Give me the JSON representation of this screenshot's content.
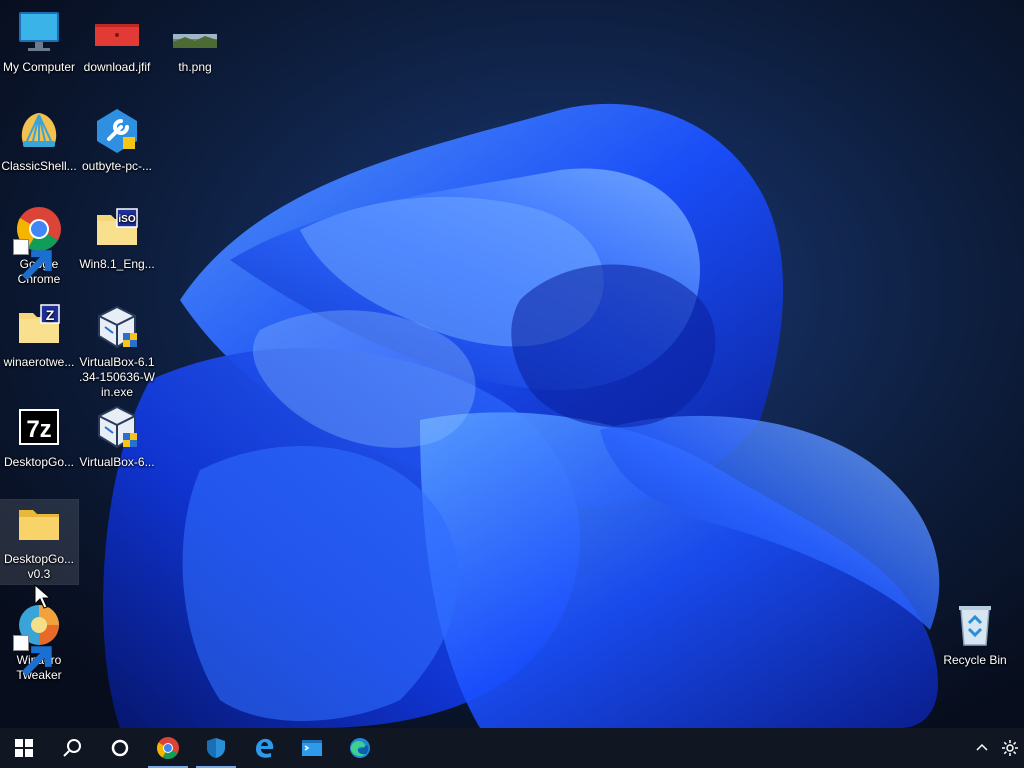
{
  "desktop": {
    "icons": [
      {
        "id": "my-computer",
        "label": "My Computer",
        "icon": "monitor-icon"
      },
      {
        "id": "download-jfif",
        "label": "download.jfif",
        "icon": "image-file-icon"
      },
      {
        "id": "th-png",
        "label": "th.png",
        "icon": "image-file-icon"
      },
      {
        "id": "classicshell",
        "label": "ClassicShell...",
        "icon": "shell-icon"
      },
      {
        "id": "outbyte",
        "label": "outbyte-pc-...",
        "icon": "wrench-icon"
      },
      {
        "id": "google-chrome",
        "label": "Google Chrome",
        "icon": "chrome-icon"
      },
      {
        "id": "win81",
        "label": "Win8.1_Eng...",
        "icon": "iso-folder-icon"
      },
      {
        "id": "winaerotweaker-zip",
        "label": "winaerotwe...",
        "icon": "zip-folder-icon"
      },
      {
        "id": "virtualbox-exe",
        "label": "VirtualBox-6.1.34-150636-Win.exe",
        "icon": "virtualbox-icon"
      },
      {
        "id": "desktopgo-7z",
        "label": "DesktopGo...",
        "icon": "7zip-icon"
      },
      {
        "id": "virtualbox-2",
        "label": "VirtualBox-6...",
        "icon": "virtualbox-icon"
      },
      {
        "id": "desktopgo-folder",
        "label": "DesktopGo... v0.3",
        "icon": "folder-icon"
      },
      {
        "id": "winaero-tweaker",
        "label": "Winaero Tweaker",
        "icon": "winaero-icon"
      },
      {
        "id": "recycle-bin",
        "label": "Recycle Bin",
        "icon": "recycle-bin-icon"
      }
    ],
    "vbox_line1": "VirtualBox-6.1",
    "vbox_line2": ".34-150636-W",
    "vbox_line3": "in.exe",
    "desktopgo_line1": "DesktopGo...",
    "desktopgo_line2": "v0.3",
    "chrome_line1": "Google",
    "chrome_line2": "Chrome",
    "winaero_line1": "Winaero",
    "winaero_line2": "Tweaker"
  },
  "taskbar": {
    "items": [
      {
        "name": "start-button",
        "icon": "windows-logo-icon"
      },
      {
        "name": "search-button",
        "icon": "search-icon"
      },
      {
        "name": "cortana-button",
        "icon": "cortana-circle-icon"
      },
      {
        "name": "chrome-taskbar",
        "icon": "chrome-icon"
      },
      {
        "name": "security-taskbar",
        "icon": "shield-icon"
      },
      {
        "name": "edge-legacy-taskbar",
        "icon": "edge-legacy-icon"
      },
      {
        "name": "terminal-taskbar",
        "icon": "terminal-icon"
      },
      {
        "name": "edge-taskbar",
        "icon": "edge-icon"
      }
    ],
    "tray": [
      {
        "name": "show-hidden-icons",
        "icon": "chevron-up-icon"
      },
      {
        "name": "settings-tray",
        "icon": "gear-icon"
      }
    ]
  },
  "colors": {
    "wallpaper_bg": "#0a1428",
    "bloom_blue": "#1a4fff",
    "taskbar_bg": "#101622",
    "running_indicator": "#7aa9e8"
  }
}
